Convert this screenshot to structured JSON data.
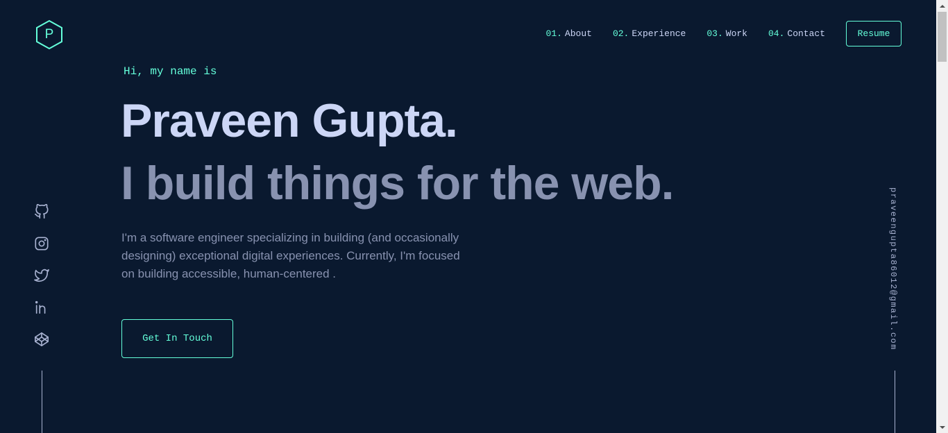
{
  "logo": {
    "letter": "P"
  },
  "nav": {
    "items": [
      {
        "num": "01.",
        "label": "About"
      },
      {
        "num": "02.",
        "label": "Experience"
      },
      {
        "num": "03.",
        "label": "Work"
      },
      {
        "num": "04.",
        "label": "Contact"
      }
    ],
    "resume_label": "Resume"
  },
  "hero": {
    "greeting": "Hi, my name is",
    "name": "Praveen Gupta.",
    "tagline": "I build things for the web.",
    "description": "I'm a software engineer specializing in building (and occasionally designing) exceptional digital experiences. Currently, I'm focused on building accessible, human-centered .",
    "cta_label": "Get In Touch"
  },
  "social": {
    "icons": [
      "github-icon",
      "instagram-icon",
      "twitter-icon",
      "linkedin-icon",
      "codepen-icon"
    ]
  },
  "email": "praveengupta86012@gmail.com",
  "colors": {
    "background": "#0a192f",
    "accent": "#64ffda",
    "heading": "#ccd6f6",
    "text": "#8892b0"
  }
}
